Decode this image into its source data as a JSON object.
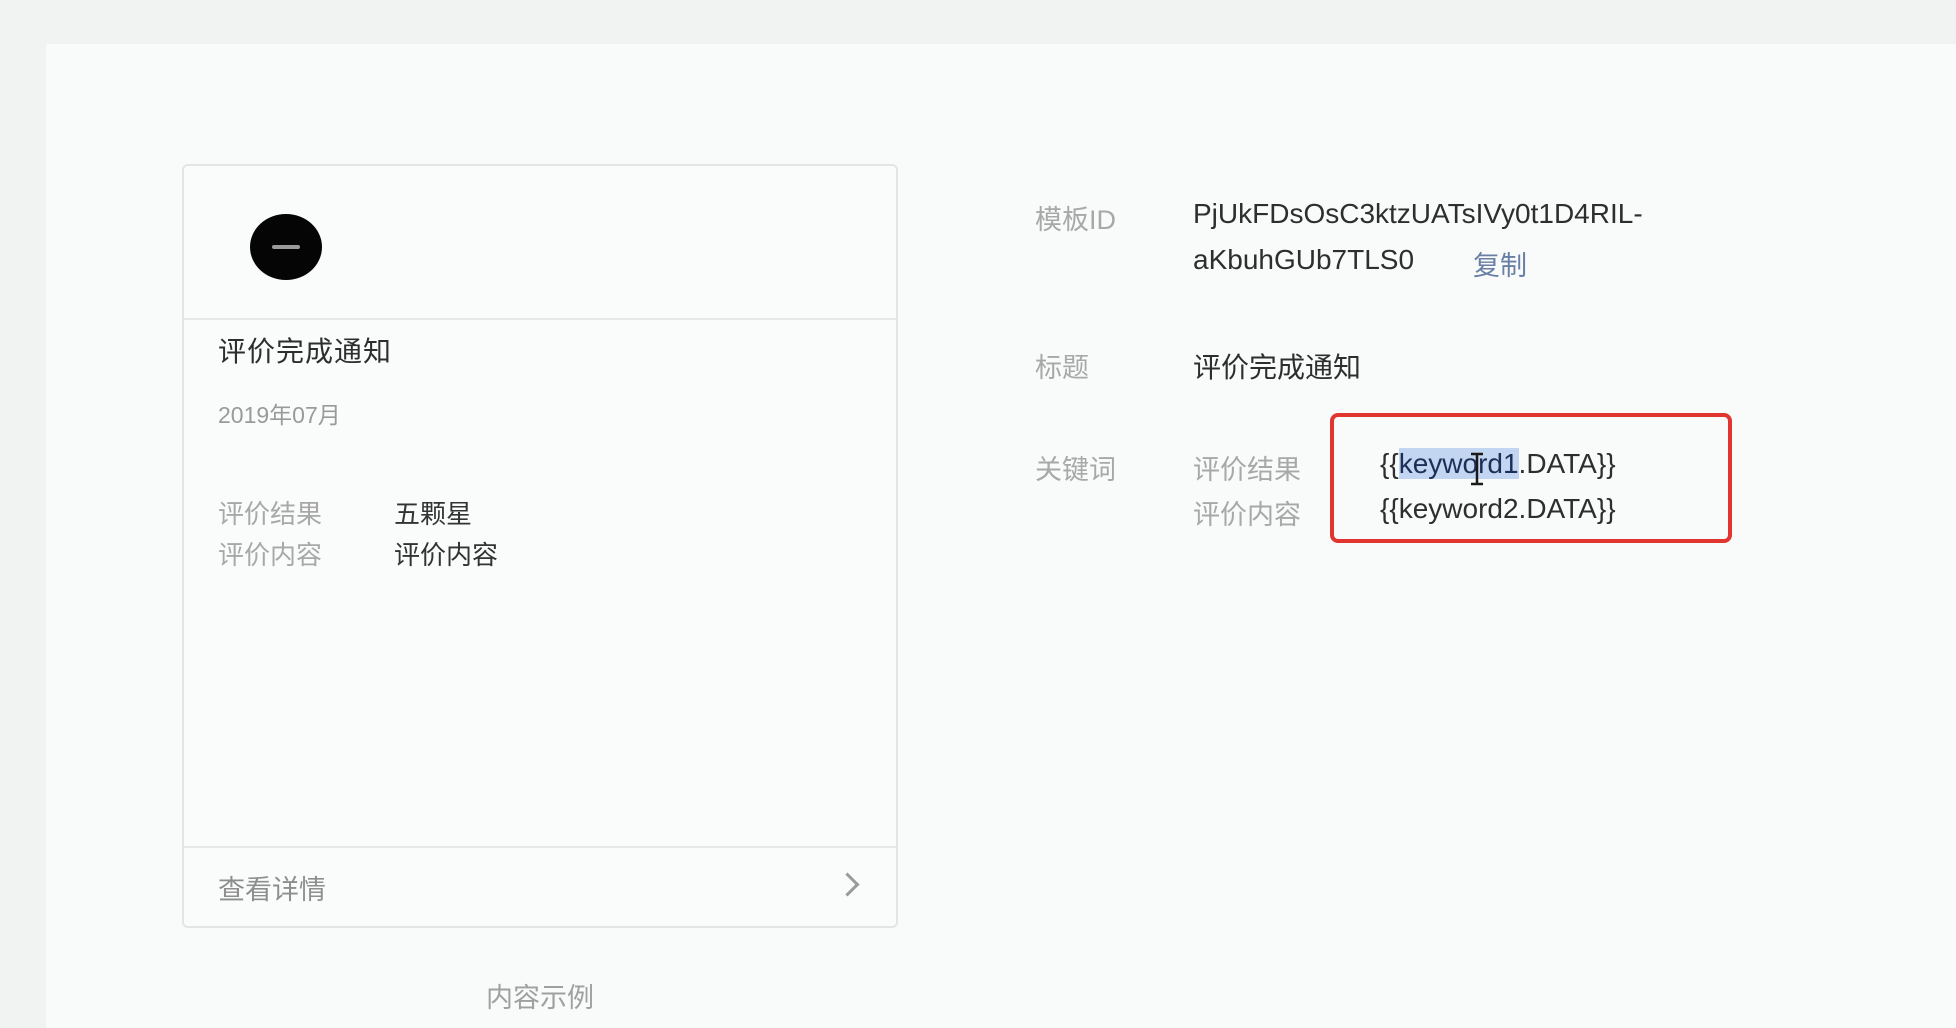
{
  "preview": {
    "title": "评价完成通知",
    "date": "2019年07月",
    "rows": [
      {
        "key": "评价结果",
        "value": "五颗星"
      },
      {
        "key": "评价内容",
        "value": "评价内容"
      }
    ],
    "footer_link": "查看详情",
    "caption": "内容示例"
  },
  "details": {
    "template_id_label": "模板ID",
    "template_id_line1": "PjUkFDsOsC3ktzUATsIVy0t1D4RIL-",
    "template_id_line2": "aKbuhGUb7TLS0",
    "copy_label": "复制",
    "title_label": "标题",
    "title_value": "评价完成通知",
    "keywords_label": "关键词",
    "keywords": [
      {
        "name": "评价结果",
        "prefix": "{{",
        "selected": "keyword1",
        "suffix": ".DATA}}"
      },
      {
        "name": "评价内容",
        "value": "{{keyword2.DATA}}"
      }
    ]
  },
  "colors": {
    "highlight_border": "#e0362f",
    "link": "#6a7fa5",
    "selection": "#c2d6f2"
  },
  "icons": {
    "footer_arrow": "chevron-right-icon",
    "cursor": "text-cursor-icon",
    "avatar": "account-avatar"
  }
}
